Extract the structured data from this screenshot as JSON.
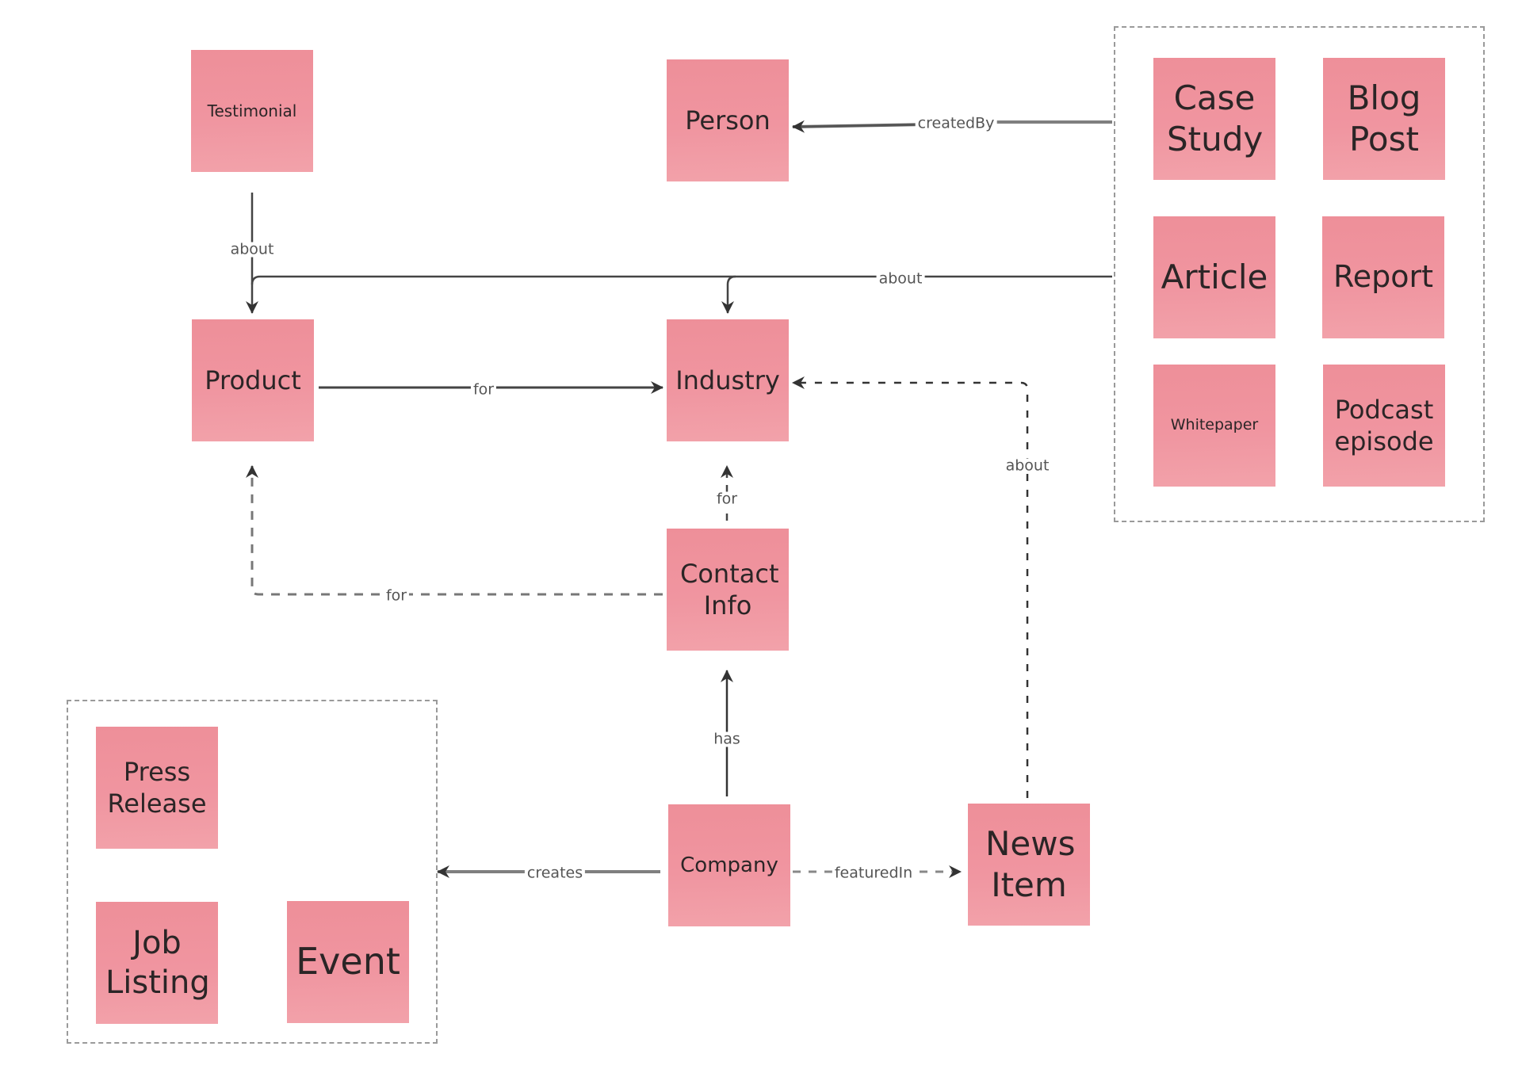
{
  "diagram": {
    "type": "content-model concept map",
    "colors": {
      "note": "#F0929C",
      "note_text": "#2B2526",
      "edge_solid": "#333333",
      "edge_muted": "#8A8A8A",
      "group_border": "#9A9A9A",
      "label_text": "#555555"
    },
    "nodes": {
      "testimonial": "Testimonial",
      "person": "Person",
      "product": "Product",
      "industry": "Industry",
      "contact_info": "Contact Info",
      "company": "Company",
      "news_item": "News Item",
      "case_study": "Case Study",
      "blog_post": "Blog Post",
      "article": "Article",
      "report": "Report",
      "whitepaper": "Whitepaper",
      "podcast_episode": "Podcast episode",
      "press_release": "Press Release",
      "job_listing": "Job Listing",
      "event": "Event"
    },
    "groups": {
      "content_types": [
        "Case Study",
        "Blog Post",
        "Article",
        "Report",
        "Whitepaper",
        "Podcast episode"
      ],
      "company_outputs": [
        "Press Release",
        "Job Listing",
        "Event"
      ]
    },
    "edges": [
      {
        "id": "testimonial-about-product",
        "from": "Testimonial",
        "to": "Product",
        "label": "about",
        "style": "solid"
      },
      {
        "id": "content-createdBy-person",
        "from": "Content group",
        "to": "Person",
        "label": "createdBy",
        "style": "solid"
      },
      {
        "id": "content-about",
        "from": "Content group",
        "to": "Product, Industry",
        "label": "about",
        "style": "solid"
      },
      {
        "id": "product-for-industry",
        "from": "Product",
        "to": "Industry",
        "label": "for",
        "style": "solid"
      },
      {
        "id": "contact-for-industry",
        "from": "Contact Info",
        "to": "Industry",
        "label": "for",
        "style": "dashed"
      },
      {
        "id": "contact-for-product",
        "from": "Contact Info",
        "to": "Product",
        "label": "for",
        "style": "dashed"
      },
      {
        "id": "news-about-industry",
        "from": "News Item",
        "to": "Industry",
        "label": "about",
        "style": "dashed"
      },
      {
        "id": "company-has-contact",
        "from": "Company",
        "to": "Contact Info",
        "label": "has",
        "style": "solid"
      },
      {
        "id": "company-creates-group",
        "from": "Company",
        "to": "Company outputs group",
        "label": "creates",
        "style": "solid"
      },
      {
        "id": "company-featuredIn-news",
        "from": "Company",
        "to": "News Item",
        "label": "featuredIn",
        "style": "dashed"
      }
    ]
  }
}
